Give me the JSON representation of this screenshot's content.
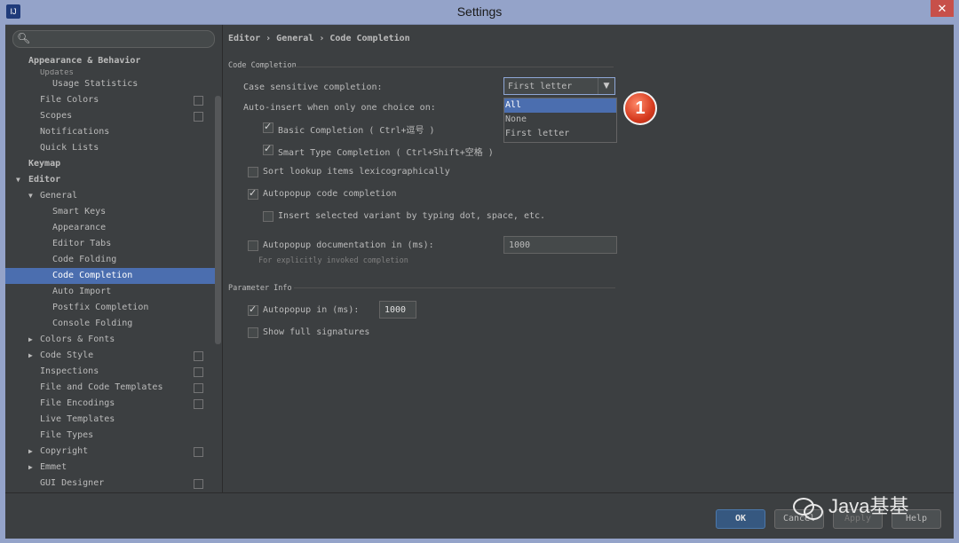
{
  "window": {
    "title": "Settings",
    "close_glyph": "✕",
    "app_icon": "IJ"
  },
  "sidebar": {
    "search_icon": "search-icon",
    "items": [
      {
        "label": "Appearance & Behavior",
        "level": 1,
        "bold": true,
        "arrow": ""
      },
      {
        "label": "Updates",
        "level": 2,
        "clipped": true
      },
      {
        "label": "Usage Statistics",
        "level": 3
      },
      {
        "label": "File Colors",
        "level": 2,
        "proj": true
      },
      {
        "label": "Scopes",
        "level": 2,
        "proj": true
      },
      {
        "label": "Notifications",
        "level": 2
      },
      {
        "label": "Quick Lists",
        "level": 2
      },
      {
        "label": "Keymap",
        "level": 1,
        "bold": true
      },
      {
        "label": "Editor",
        "level": 1,
        "bold": true,
        "arrow": "▼"
      },
      {
        "label": "General",
        "level": 2,
        "arrow": "▼"
      },
      {
        "label": "Smart Keys",
        "level": 3
      },
      {
        "label": "Appearance",
        "level": 3
      },
      {
        "label": "Editor Tabs",
        "level": 3
      },
      {
        "label": "Code Folding",
        "level": 3
      },
      {
        "label": "Code Completion",
        "level": 3,
        "selected": true
      },
      {
        "label": "Auto Import",
        "level": 3
      },
      {
        "label": "Postfix Completion",
        "level": 3
      },
      {
        "label": "Console Folding",
        "level": 3
      },
      {
        "label": "Colors & Fonts",
        "level": 2,
        "arrow": "▶"
      },
      {
        "label": "Code Style",
        "level": 2,
        "arrow": "▶",
        "proj": true
      },
      {
        "label": "Inspections",
        "level": 2,
        "proj": true
      },
      {
        "label": "File and Code Templates",
        "level": 2,
        "proj": true
      },
      {
        "label": "File Encodings",
        "level": 2,
        "proj": true
      },
      {
        "label": "Live Templates",
        "level": 2
      },
      {
        "label": "File Types",
        "level": 2
      },
      {
        "label": "Copyright",
        "level": 2,
        "arrow": "▶",
        "proj": true
      },
      {
        "label": "Emmet",
        "level": 2,
        "arrow": "▶"
      },
      {
        "label": "GUI Designer",
        "level": 2,
        "proj": true
      }
    ]
  },
  "content": {
    "breadcrumb": "Editor › General › Code Completion",
    "code_completion_title": "Code Completion",
    "case_sensitive_label": "Case sensitive completion:",
    "case_sensitive_value": "First letter",
    "dropdown_options": [
      "All",
      "None",
      "First letter"
    ],
    "dropdown_highlighted": "All",
    "badge": "1",
    "auto_insert_label": "Auto-insert when only one choice on:",
    "basic_completion": "Basic Completion ( Ctrl+逗号 )",
    "smart_type_completion": "Smart Type Completion ( Ctrl+Shift+空格 )",
    "sort_lookup": "Sort lookup items lexicographically",
    "autopopup_completion": "Autopopup code completion",
    "insert_selected_variant": "Insert selected variant by typing dot, space, etc.",
    "autopopup_doc_label": "Autopopup documentation in (ms):",
    "autopopup_doc_value": "1000",
    "autopopup_doc_hint": "For explicitly invoked completion",
    "parameter_info_title": "Parameter Info",
    "param_autopopup_label": "Autopopup in (ms):",
    "param_autopopup_value": "1000",
    "show_full_signatures": "Show full signatures",
    "checks": {
      "basic_completion": true,
      "smart_type_completion": true,
      "sort_lookup": false,
      "autopopup_completion": true,
      "insert_selected_variant": false,
      "autopopup_doc": false,
      "param_autopopup": true,
      "show_full_signatures": false
    }
  },
  "buttons": {
    "ok": "OK",
    "cancel": "Cancel",
    "apply": "Apply",
    "help": "Help"
  },
  "watermark": {
    "text": "Java基基"
  }
}
